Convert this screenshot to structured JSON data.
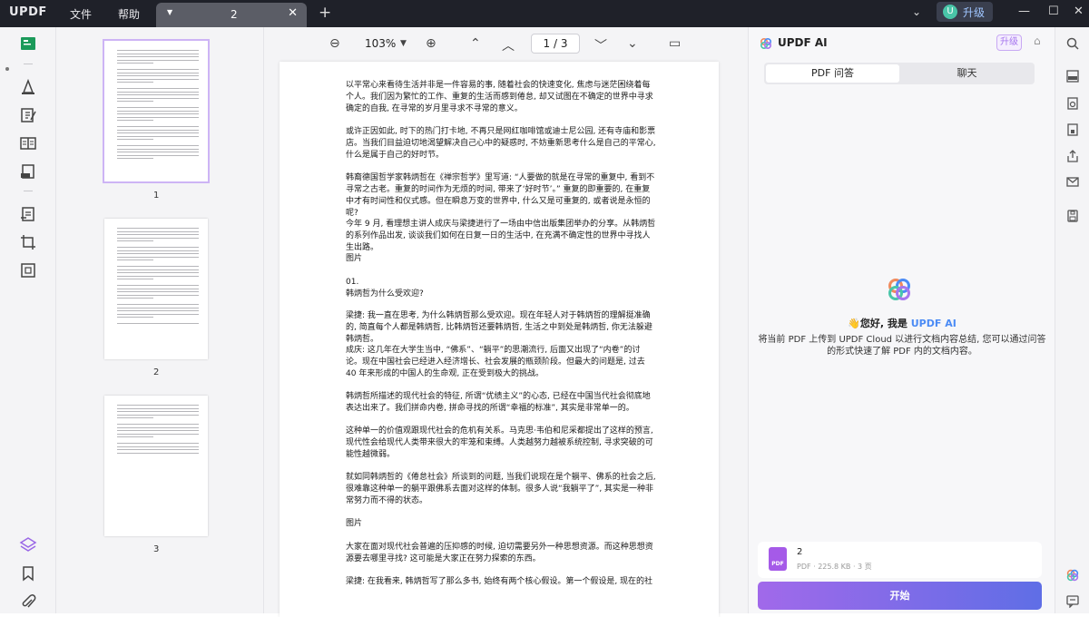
{
  "titlebar": {
    "logo": "UPDF",
    "menu_file": "文件",
    "menu_help": "帮助",
    "tab_name": "2",
    "upgrade_label": "升级",
    "avatar_letter": "U"
  },
  "doc_toolbar": {
    "zoom": "103%",
    "page_indicator": "1  /  3"
  },
  "thumbnails": [
    {
      "label": "1"
    },
    {
      "label": "2"
    },
    {
      "label": "3"
    }
  ],
  "document": {
    "paragraphs": [
      "以平常心来看待生活并非是一件容易的事, 随着社会的快速变化, 焦虑与迷茫困绕着每个人。我们因为繁忙的工作、重复的生活而感到倦怠, 却又试图在不确定的世界中寻求确定的自我, 在寻常的岁月里寻求不寻常的意义。",
      "或许正因如此, 时下的热门打卡地, 不再只是网红咖啡馆或迪士尼公园, 还有寺庙和影票店。当我们目益迫切地渴望解决自己心中的疑惑时, 不妨重新思考什么是自己的平常心, 什么是属于自己的好时节。",
      "韩裔德国哲学家韩炳哲在《禅宗哲学》里写道: “人要做的就是在寻常的重复中, 看到不寻常之古老。重复的时间作为无烦的时间, 带来了‘好时节’。” 重复的即重要的, 在重复中才有时间性和仪式感。但在瞬息万变的世界中, 什么又是可重复的, 或者说是永恒的呢?",
      "今年 9 月, 看理想主讲人成庆与梁捷进行了一场由中信出版集团举办的分享。从韩炳哲的系列作品出发, 谈谈我们如何在日复一日的生活中, 在充满不确定性的世界中寻找人生出路。",
      "图片",
      "01.\n韩炳哲为什么受欢迎?",
      "梁捷: 我一直在思考, 为什么韩炳哲那么受欢迎。现在年轻人对于韩炳哲的理解挺准确的, 简直每个人都是韩炳哲, 比韩炳哲还要韩炳哲, 生活之中到处是韩炳哲, 你无法躲避韩炳哲。",
      "成庆: 这几年在大学生当中, “佛系”、“躺平”的思潮流行, 后面又出现了“内卷”的讨论。现在中国社会已经进入经济增长、社会发展的瓶颈阶段。但最大的问题是, 过去 40 年来形成的中国人的生命观, 正在受到极大的挑战。",
      "韩炳哲所描述的现代社会的特征, 所谓“优绩主义”的心态, 已经在中国当代社会彻底地表达出来了。我们拼命内卷, 拼命寻找的所谓“幸福的标准”, 其实是非常单一的。",
      "这种单一的价值观跟现代社会的危机有关系。马克思·韦伯和尼采都提出了这样的预言, 现代性会给现代人类带来很大的牢笼和束缚。人类越努力越被系统控制, 寻求突破的可能性越微弱。",
      "就如同韩炳哲的《倦怠社会》所谈到的问题, 当我们说现在是个躺平、佛系的社会之后, 很难靠这种单一的躺平跟佛系去面对这样的体制。很多人说“我躺平了”, 其实是一种非常努力而不得的状态。",
      "图片",
      "大家在面对现代社会普遍的压抑感的时候, 迫切需要另外一种思想资源。而这种思想资源要去哪里寻找? 这可能是大家正在努力探索的东西。",
      "梁捷: 在我看来, 韩炳哲写了那么多书, 始终有两个核心假设。第一个假设是, 现在的社会"
    ]
  },
  "ai_panel": {
    "title": "UPDF AI",
    "upgrade": "升级",
    "tab_pdf": "PDF 问答",
    "tab_chat": "聊天",
    "greeting_prefix": "您好, 我是",
    "greeting_brand": "UPDF AI",
    "description": "将当前 PDF 上传到 UPDF Cloud 以进行文档内容总结, 您可以通过问答的形式快速了解 PDF 内的文档内容。",
    "file_name": "2",
    "file_meta": "PDF · 225.8 KB · 3 页",
    "start_button": "开始"
  },
  "colors": {
    "titlebar_bg": "#1f2129",
    "accent_purple": "#a676ee",
    "brand_blue": "#4b8bf5"
  }
}
